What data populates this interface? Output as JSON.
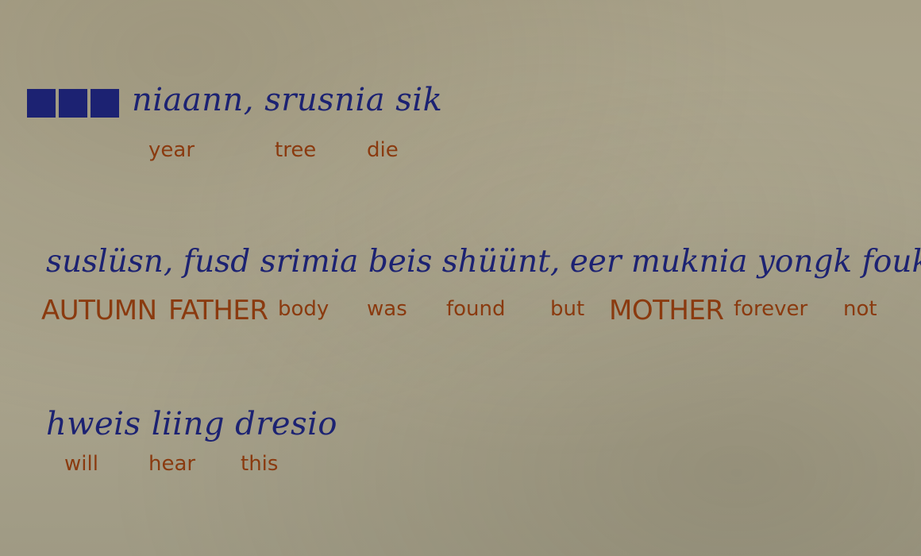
{
  "colors": {
    "script_ink": "#1c2272",
    "gloss_ink": "#8a3a0f",
    "paper": "#a8a28b"
  },
  "redaction_blocks": 3,
  "line1": {
    "script": "niaann, srusnia sik",
    "glosses": [
      "year",
      "tree",
      "die"
    ]
  },
  "line2": {
    "script": "suslüsn, fusd srimia beis shüünt, eer muknia yongk fouk",
    "glosses": [
      "AUTUMN",
      "FATHER",
      "body",
      "was",
      "found",
      "but",
      "MOTHER",
      "forever",
      "not"
    ]
  },
  "line3": {
    "script": "hweis liing dresio",
    "glosses": [
      "will",
      "hear",
      "this"
    ]
  }
}
